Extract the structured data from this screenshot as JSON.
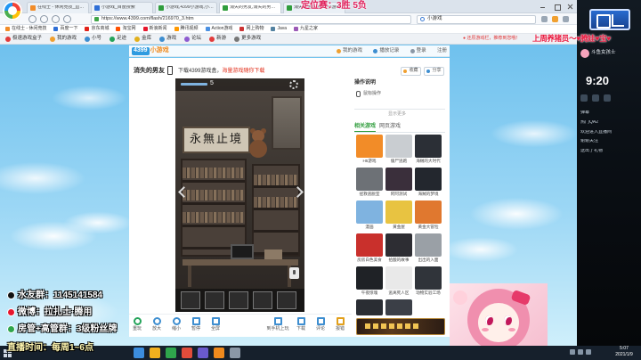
{
  "browser": {
    "title_overlay": "定位赛：3胜 5负",
    "tabs": [
      {
        "label": "在线士 - 休闲竞技_直播间",
        "color": "#f28c28",
        "active": false
      },
      {
        "label": "小游戏_百度搜索",
        "color": "#2f6fd6",
        "active": false
      },
      {
        "label": "小游戏,4399小游戏,小游戏大全",
        "color": "#2f9d3c",
        "active": false
      },
      {
        "label": "消失的男友,消失的男友小游戏",
        "color": "#2f9d3c",
        "active": true
      },
      {
        "label": "消失的男友,4399小游戏",
        "color": "#2f9d3c",
        "active": false
      }
    ],
    "address": "https://www.4399.com/flash/216970_3.htm",
    "search_value": "小游戏",
    "bookmarks": [
      {
        "label": "在线士 - 休闲竞技",
        "color": "#f28c28"
      },
      {
        "label": "百度一下",
        "color": "#2f6fd6"
      },
      {
        "label": "京东商城",
        "color": "#e2231a"
      },
      {
        "label": "淘宝网",
        "color": "#ff5000"
      },
      {
        "label": "新浪新闻",
        "color": "#e6162d"
      },
      {
        "label": "腾讯视频",
        "color": "#ff9900"
      },
      {
        "label": "Action游戏",
        "color": "#4a90e2"
      },
      {
        "label": "网上购物",
        "color": "#c33"
      },
      {
        "label": "Java",
        "color": "#5382a1"
      },
      {
        "label": "九星之家",
        "color": "#9b59b6"
      }
    ],
    "toolbar_items": [
      {
        "label": "极速游戏盒子",
        "color": "#e23b3b"
      },
      {
        "label": "我的游戏",
        "color": "#f0a030"
      },
      {
        "label": "小号",
        "color": "#3e8ed0"
      },
      {
        "label": "足迹",
        "color": "#25a35a"
      },
      {
        "label": "金库",
        "color": "#e2b01c"
      },
      {
        "label": "游戏",
        "color": "#3e8ed0"
      },
      {
        "label": "论坛",
        "color": "#8e5bd0"
      },
      {
        "label": "新游",
        "color": "#e23b3b"
      },
      {
        "label": "更多游戏",
        "color": "#777"
      }
    ],
    "toolbar_notice": "● 还原游戏栏，推荐到您哦！"
  },
  "site": {
    "logo_num": "4399",
    "logo_text": "小游戏",
    "nav": {
      "my_games": "我的游戏",
      "history": "播放记录",
      "login": "登录",
      "register": "注册"
    },
    "game_title": "消失的男友",
    "promo_a": "下载4399游戏盒，",
    "promo_b": "海量游戏随你下载",
    "collect": "收藏",
    "share": "分享",
    "game": {
      "counter": "5",
      "calligraphy": "永無止境"
    },
    "instructions_title": "操作说明",
    "instructions": "鼠标操作",
    "show_more": "显示更多",
    "tab_related": "相关游戏",
    "tab_web": "网页游戏",
    "related": [
      {
        "label": "H5游戏",
        "color": "#f28c28"
      },
      {
        "label": "僵尸逃跑",
        "color": "#c9cdd1"
      },
      {
        "label": "海贼的大时代",
        "color": "#2b2f36"
      },
      {
        "label": "拯救逃脱室",
        "color": "#6d7176"
      },
      {
        "label": "阿阿测试",
        "color": "#3a2f3b"
      },
      {
        "label": "海贼的梦境",
        "color": "#23272e"
      },
      {
        "label": "漫画",
        "color": "#7fb3e0"
      },
      {
        "label": "黄金屋",
        "color": "#e8c341"
      },
      {
        "label": "黄金大冒险",
        "color": "#e0782f"
      },
      {
        "label": "房房白色美食",
        "color": "#c9302c"
      },
      {
        "label": "拾酸的故事",
        "color": "#2d2d33"
      },
      {
        "label": "出出的入面",
        "color": "#9aa0a6"
      },
      {
        "label": "午夜惊魂",
        "color": "#1f2226"
      },
      {
        "label": "逃离死人区",
        "color": "#e9e9e9"
      },
      {
        "label": "动物实验工场",
        "color": "#30343a"
      },
      {
        "label": "",
        "color": "#2a2d33"
      },
      {
        "label": "",
        "color": "#3b3f47"
      }
    ],
    "tools_left": [
      "重玩",
      "放大",
      "缩小",
      "暂停",
      "全屏"
    ],
    "tools_right": [
      "到手机上玩",
      "下载",
      "评论",
      "报错"
    ]
  },
  "stream": {
    "top_banner": "上周养猪员～♥腾娃♥宝♥",
    "info_lines": [
      "水友群：1145141584",
      "微博：拉扎士·腾用",
      "房管+高管群：3级粉丝牌",
      "直播时间：每周1~6点"
    ],
    "panel": {
      "name": "斗鱼女孩士",
      "time": "9:20",
      "chat": [
        "弹幕",
        "热门QA2",
        "欢迎进入直播间",
        "谢谢关注",
        "送出了礼物"
      ]
    }
  },
  "taskbar": {
    "time": "5:07",
    "date": "2021/1/9"
  },
  "colors": {
    "accent_green": "#2f9d3c",
    "brand_blue": "#2f9be0",
    "banner_red": "#e8163c"
  }
}
